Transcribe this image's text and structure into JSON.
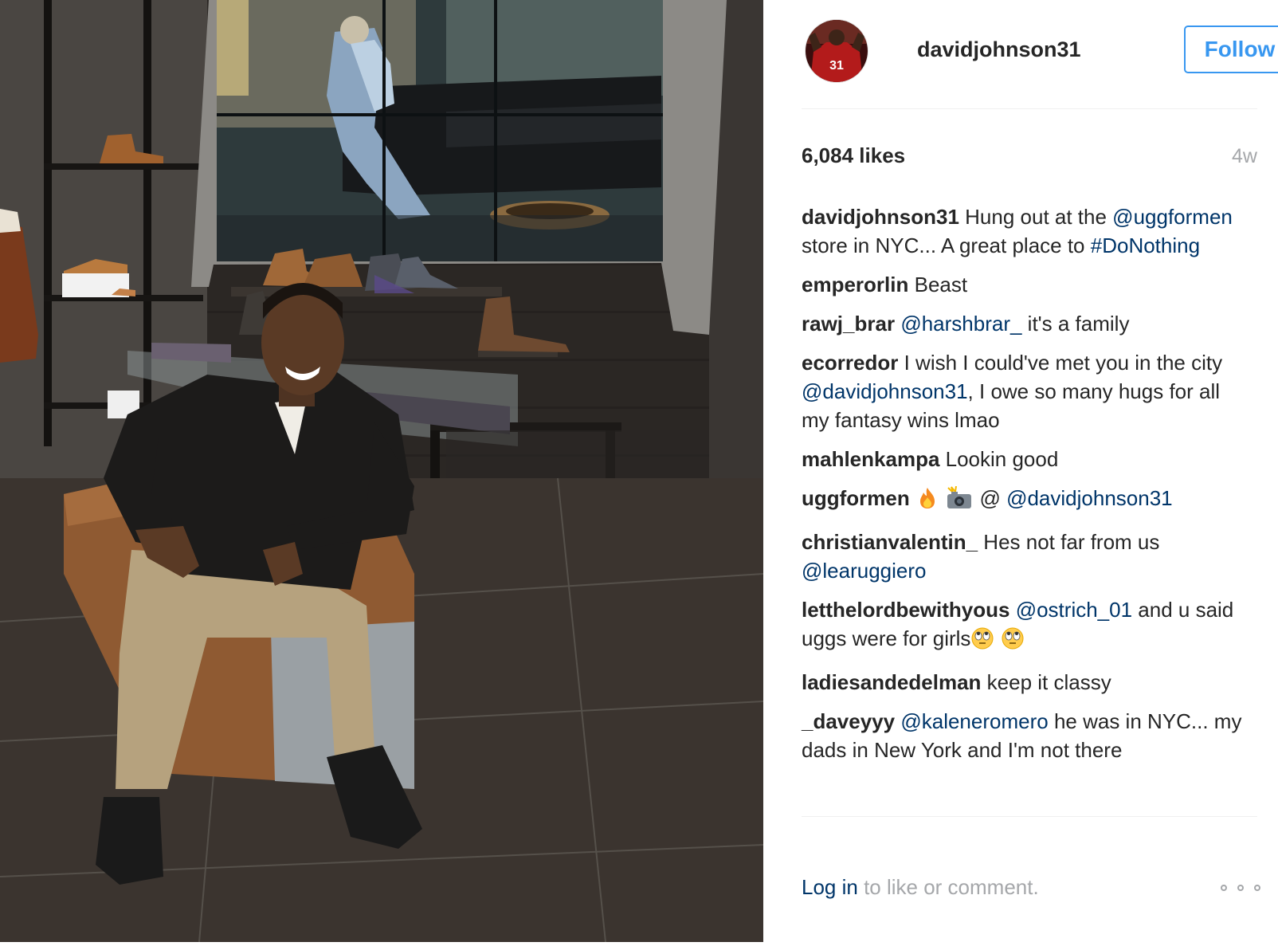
{
  "post": {
    "image_alt": "Man sitting on a leather stool in a shoe store in front of a large video wall",
    "author": {
      "username": "davidjohnson31",
      "avatar_jersey_number": "31"
    },
    "follow_label": "Follow",
    "likes": "6,084 likes",
    "age": "4w",
    "comments": [
      {
        "user": "davidjohnson31",
        "parts": [
          {
            "t": "text",
            "v": " Hung out at the "
          },
          {
            "t": "mention",
            "v": "@uggformen"
          },
          {
            "t": "text",
            "v": " store in NYC... A great place to "
          },
          {
            "t": "hashtag",
            "v": "#DoNothing"
          }
        ]
      },
      {
        "user": "emperorlin",
        "parts": [
          {
            "t": "text",
            "v": " Beast"
          }
        ]
      },
      {
        "user": "rawj_brar",
        "parts": [
          {
            "t": "text",
            "v": " "
          },
          {
            "t": "mention",
            "v": "@harshbrar_"
          },
          {
            "t": "text",
            "v": " it's a family"
          }
        ]
      },
      {
        "user": "ecorredor",
        "parts": [
          {
            "t": "text",
            "v": " I wish I could've met you in the city "
          },
          {
            "t": "mention",
            "v": "@davidjohnson31"
          },
          {
            "t": "text",
            "v": ", I owe so many hugs for all my fantasy wins lmao"
          }
        ]
      },
      {
        "user": "mahlenkampa",
        "parts": [
          {
            "t": "text",
            "v": " Lookin good"
          }
        ]
      },
      {
        "user": "uggformen",
        "parts": [
          {
            "t": "text",
            "v": " "
          },
          {
            "t": "emoji",
            "v": "fire-emoji"
          },
          {
            "t": "text",
            "v": " "
          },
          {
            "t": "emoji",
            "v": "camera-flash-emoji"
          },
          {
            "t": "text",
            "v": " @ "
          },
          {
            "t": "mention",
            "v": "@davidjohnson31"
          }
        ]
      },
      {
        "user": "christianvalentin_",
        "parts": [
          {
            "t": "text",
            "v": " Hes not far from us "
          },
          {
            "t": "mention",
            "v": "@learuggiero"
          }
        ]
      },
      {
        "user": "letthelordbewithyous",
        "parts": [
          {
            "t": "text",
            "v": " "
          },
          {
            "t": "mention",
            "v": "@ostrich_01"
          },
          {
            "t": "text",
            "v": " and u said uggs were for girls"
          },
          {
            "t": "emoji",
            "v": "eye-roll-emoji"
          },
          {
            "t": "text",
            "v": " "
          },
          {
            "t": "emoji",
            "v": "eye-roll-emoji"
          }
        ]
      },
      {
        "user": "ladiesandedelman",
        "parts": [
          {
            "t": "text",
            "v": " keep it classy"
          }
        ]
      },
      {
        "user": "_daveyyy",
        "parts": [
          {
            "t": "text",
            "v": " "
          },
          {
            "t": "mention",
            "v": "@kaleneromero"
          },
          {
            "t": "text",
            "v": " he was in NYC... my dads in New York and I'm not there"
          }
        ]
      }
    ],
    "footer": {
      "login_label": "Log in",
      "rest": " to like or comment."
    },
    "more_options_icon": "more-options-icon"
  }
}
